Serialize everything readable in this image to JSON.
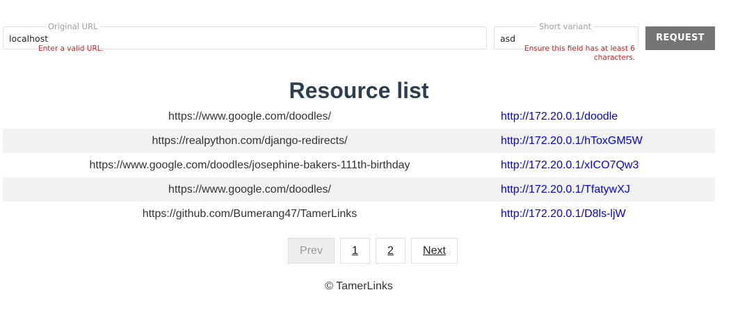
{
  "form": {
    "original_url": {
      "label": "Original URL",
      "value": "localhost",
      "error": "Enter a valid URL."
    },
    "short_variant": {
      "label": "Short variant",
      "value": "asd",
      "error": "Ensure this field has at least 6 characters."
    },
    "request_label": "REQUEST"
  },
  "title": "Resource list",
  "resources": [
    {
      "original": "https://www.google.com/doodles/",
      "short": "http://172.20.0.1/doodle"
    },
    {
      "original": "https://realpython.com/django-redirects/",
      "short": "http://172.20.0.1/hToxGM5W"
    },
    {
      "original": "https://www.google.com/doodles/josephine-bakers-111th-birthday",
      "short": "http://172.20.0.1/xICO7Qw3"
    },
    {
      "original": "https://www.google.com/doodles/",
      "short": "http://172.20.0.1/TfatywXJ"
    },
    {
      "original": "https://github.com/Bumerang47/TamerLinks",
      "short": "http://172.20.0.1/D8ls-ljW"
    }
  ],
  "pagination": {
    "prev": "Prev",
    "pages": [
      "1",
      "2"
    ],
    "next": "Next"
  },
  "footer": "© TamerLinks",
  "colors": {
    "title": "#2c3e50",
    "link": "#0000ee",
    "error": "#c62828",
    "button": "#757575",
    "stripe": "#f2f2f2"
  }
}
